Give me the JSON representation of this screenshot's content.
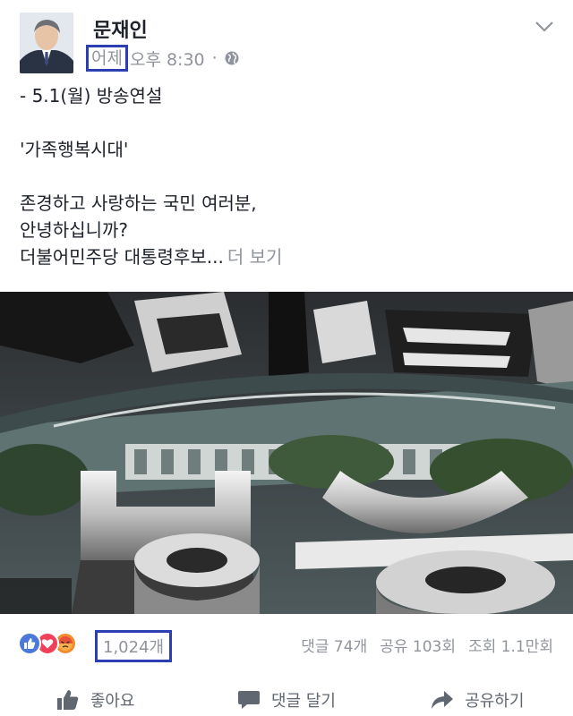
{
  "post": {
    "author": "문재인",
    "day": "어제",
    "time": "오후 8:30",
    "separator": "·",
    "privacy_icon": "globe-icon",
    "menu_icon": "chevron-down-icon"
  },
  "content": {
    "lines": [
      "- 5.1(월) 방송연설",
      "'가족행복시대'",
      "존경하고 사랑하는 국민 여러분,",
      "안녕하십니까?",
      "더불어민주당 대통령후보..."
    ],
    "more": "더 보기"
  },
  "stats": {
    "reactions": [
      "like-reaction-icon",
      "love-reaction-icon",
      "angry-reaction-icon"
    ],
    "reaction_count": "1,024개",
    "comments": "댓글 74개",
    "shares": "공유 103회",
    "views": "조회 1.1만회"
  },
  "actions": {
    "like": "좋아요",
    "comment": "댓글 달기",
    "share": "공유하기"
  },
  "colors": {
    "highlight": "#2b3fb3",
    "like": "#4a79d9",
    "love": "#f0405a",
    "angry": "#f28a2e",
    "meta_text": "#90949c"
  }
}
